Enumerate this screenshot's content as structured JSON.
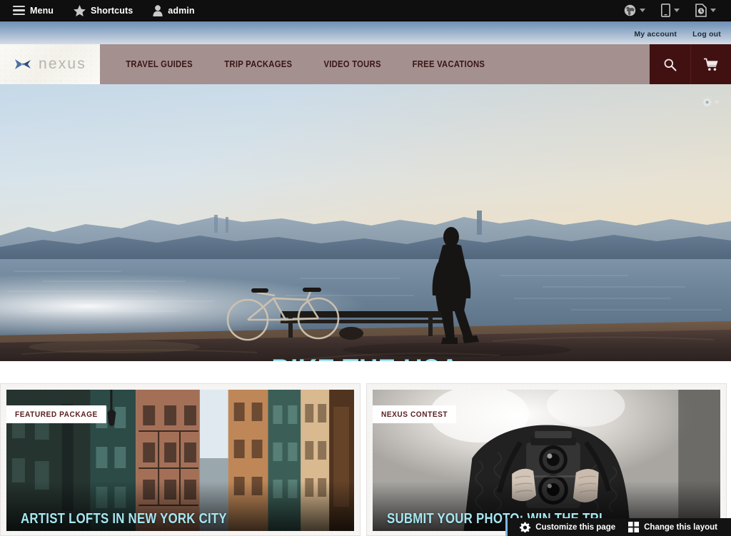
{
  "admin_toolbar": {
    "menu_label": "Menu",
    "shortcuts_label": "Shortcuts",
    "user_label": "admin",
    "icons": [
      {
        "name": "globe-icon",
        "title": "Stores"
      },
      {
        "name": "mobile-device-icon",
        "title": "Device preview"
      },
      {
        "name": "page-clock-icon",
        "title": "Version history"
      }
    ]
  },
  "account_bar": {
    "my_account_label": "My account",
    "log_out_label": "Log out"
  },
  "site_header": {
    "logo_text": "nexus",
    "logo_icon": "butterfly-plane-icon",
    "nav": [
      {
        "label": "TRAVEL GUIDES"
      },
      {
        "label": "TRIP PACKAGES"
      },
      {
        "label": "VIDEO TOURS"
      },
      {
        "label": "FREE VACATIONS"
      }
    ],
    "search_icon": "search-icon",
    "cart_icon": "shopping-cart-icon",
    "nav_background": "#a3908f",
    "action_background": "#411111"
  },
  "hero": {
    "title": "BIKE THE USA",
    "title_color": "#9fe4f0",
    "settings_icon": "gear-icon",
    "alt": "Silhouette of a man standing by a lake at sunset next to a bicycle on a stone pier"
  },
  "cards": [
    {
      "badge": "FEATURED PACKAGE",
      "title": "ARTIST LOFTS IN NEW YORK CITY",
      "alt": "Street view of colorful brick buildings with fire escapes in New York City"
    },
    {
      "badge": "NEXUS CONTEST",
      "title": "SUBMIT YOUR PHOTO: WIN THE TRI",
      "alt": "Black and white photo of a person holding a twin-lens reflex camera"
    }
  ],
  "bottom_bar": {
    "customize_label": "Customize this page",
    "customize_icon": "gear-icon",
    "layout_label": "Change this layout",
    "layout_icon": "grid-layout-icon",
    "accent_color": "#7fb6e8"
  }
}
